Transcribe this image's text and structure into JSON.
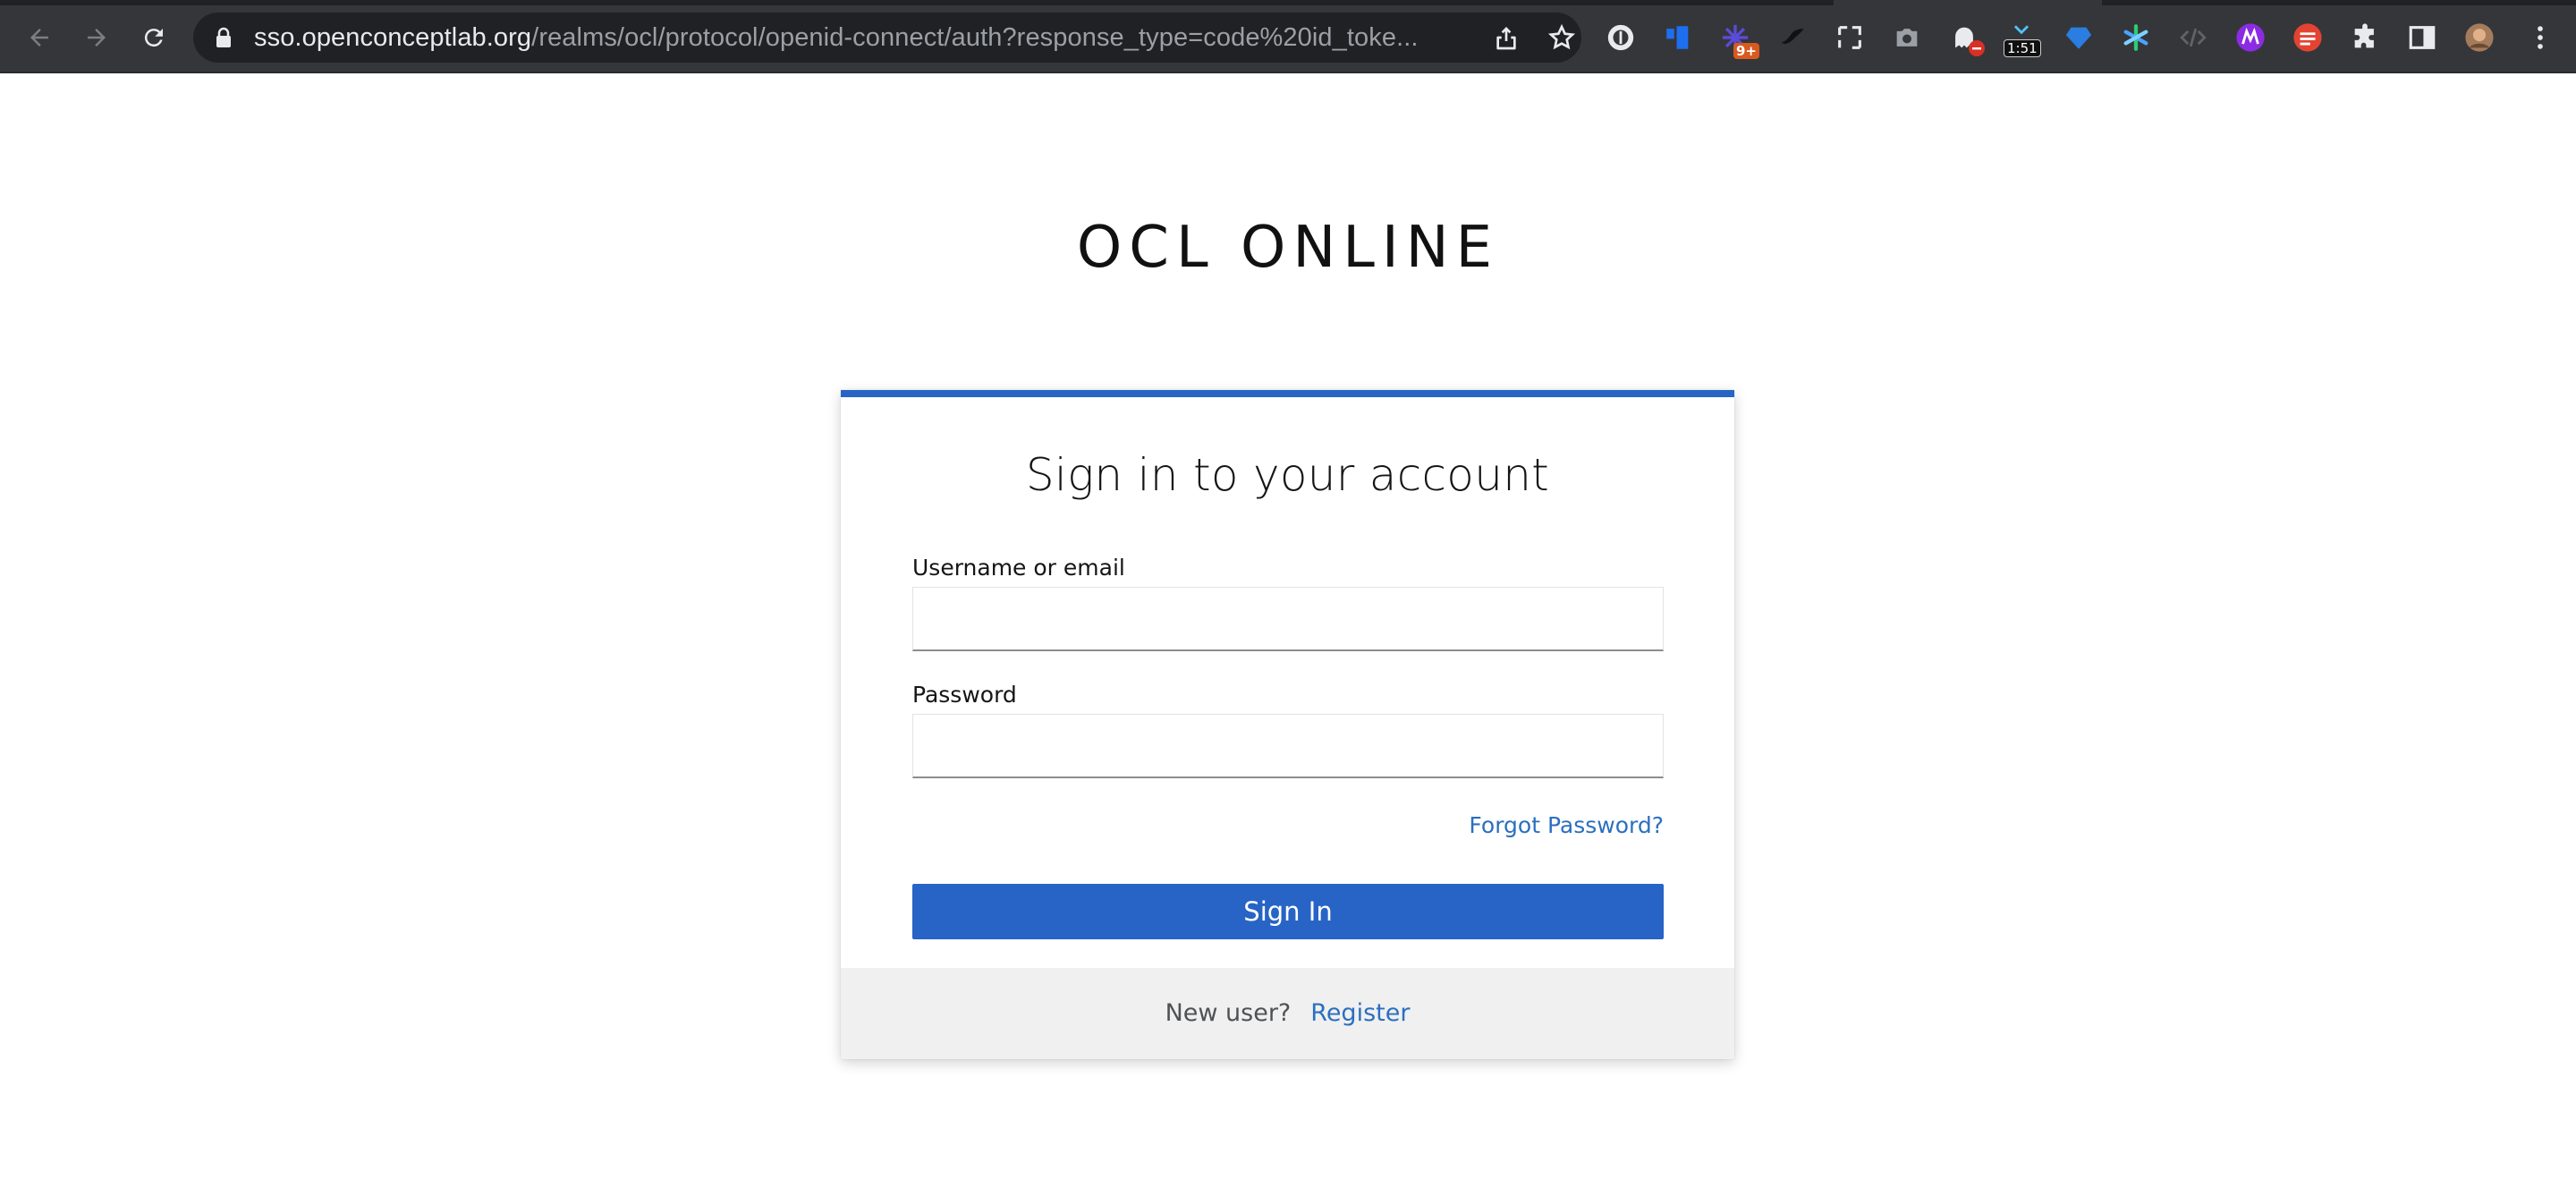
{
  "browser": {
    "url_host": "sso.openconceptlab.org",
    "url_path": "/realms/ocl/protocol/openid-connect/auth?response_type=code%20id_toke...",
    "extensions": {
      "notifications_badge": "9+",
      "timer_badge": "1:51"
    },
    "colors": {
      "toolbar": "#35363a",
      "omnibox": "#202124"
    }
  },
  "page": {
    "site_title": "OCL ONLINE",
    "card": {
      "title": "Sign in to your account",
      "username_label": "Username or email",
      "username_value": "",
      "password_label": "Password",
      "password_value": "",
      "forgot_password": "Forgot Password?",
      "sign_in_button": "Sign In",
      "new_user_text": "New user?",
      "register_link": "Register"
    },
    "colors": {
      "accent": "#2764c6",
      "link": "#2b6fbf",
      "footer_bg": "#f0f0f0"
    }
  }
}
